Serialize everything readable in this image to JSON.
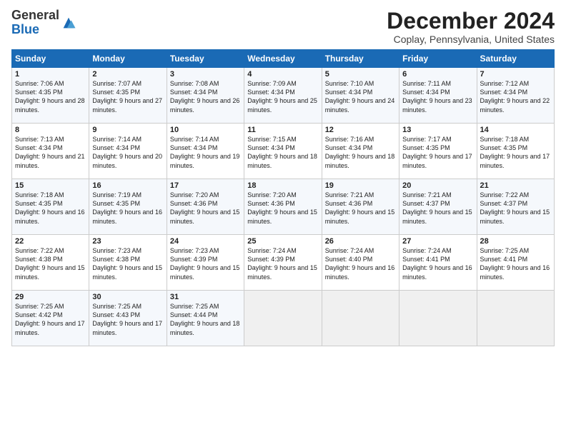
{
  "logo": {
    "general": "General",
    "blue": "Blue"
  },
  "title": "December 2024",
  "location": "Coplay, Pennsylvania, United States",
  "days_of_week": [
    "Sunday",
    "Monday",
    "Tuesday",
    "Wednesday",
    "Thursday",
    "Friday",
    "Saturday"
  ],
  "weeks": [
    [
      {
        "day": "1",
        "sunrise": "7:06 AM",
        "sunset": "4:35 PM",
        "daylight": "9 hours and 28 minutes."
      },
      {
        "day": "2",
        "sunrise": "7:07 AM",
        "sunset": "4:35 PM",
        "daylight": "9 hours and 27 minutes."
      },
      {
        "day": "3",
        "sunrise": "7:08 AM",
        "sunset": "4:34 PM",
        "daylight": "9 hours and 26 minutes."
      },
      {
        "day": "4",
        "sunrise": "7:09 AM",
        "sunset": "4:34 PM",
        "daylight": "9 hours and 25 minutes."
      },
      {
        "day": "5",
        "sunrise": "7:10 AM",
        "sunset": "4:34 PM",
        "daylight": "9 hours and 24 minutes."
      },
      {
        "day": "6",
        "sunrise": "7:11 AM",
        "sunset": "4:34 PM",
        "daylight": "9 hours and 23 minutes."
      },
      {
        "day": "7",
        "sunrise": "7:12 AM",
        "sunset": "4:34 PM",
        "daylight": "9 hours and 22 minutes."
      }
    ],
    [
      {
        "day": "8",
        "sunrise": "7:13 AM",
        "sunset": "4:34 PM",
        "daylight": "9 hours and 21 minutes."
      },
      {
        "day": "9",
        "sunrise": "7:14 AM",
        "sunset": "4:34 PM",
        "daylight": "9 hours and 20 minutes."
      },
      {
        "day": "10",
        "sunrise": "7:14 AM",
        "sunset": "4:34 PM",
        "daylight": "9 hours and 19 minutes."
      },
      {
        "day": "11",
        "sunrise": "7:15 AM",
        "sunset": "4:34 PM",
        "daylight": "9 hours and 18 minutes."
      },
      {
        "day": "12",
        "sunrise": "7:16 AM",
        "sunset": "4:34 PM",
        "daylight": "9 hours and 18 minutes."
      },
      {
        "day": "13",
        "sunrise": "7:17 AM",
        "sunset": "4:35 PM",
        "daylight": "9 hours and 17 minutes."
      },
      {
        "day": "14",
        "sunrise": "7:18 AM",
        "sunset": "4:35 PM",
        "daylight": "9 hours and 17 minutes."
      }
    ],
    [
      {
        "day": "15",
        "sunrise": "7:18 AM",
        "sunset": "4:35 PM",
        "daylight": "9 hours and 16 minutes."
      },
      {
        "day": "16",
        "sunrise": "7:19 AM",
        "sunset": "4:35 PM",
        "daylight": "9 hours and 16 minutes."
      },
      {
        "day": "17",
        "sunrise": "7:20 AM",
        "sunset": "4:36 PM",
        "daylight": "9 hours and 15 minutes."
      },
      {
        "day": "18",
        "sunrise": "7:20 AM",
        "sunset": "4:36 PM",
        "daylight": "9 hours and 15 minutes."
      },
      {
        "day": "19",
        "sunrise": "7:21 AM",
        "sunset": "4:36 PM",
        "daylight": "9 hours and 15 minutes."
      },
      {
        "day": "20",
        "sunrise": "7:21 AM",
        "sunset": "4:37 PM",
        "daylight": "9 hours and 15 minutes."
      },
      {
        "day": "21",
        "sunrise": "7:22 AM",
        "sunset": "4:37 PM",
        "daylight": "9 hours and 15 minutes."
      }
    ],
    [
      {
        "day": "22",
        "sunrise": "7:22 AM",
        "sunset": "4:38 PM",
        "daylight": "9 hours and 15 minutes."
      },
      {
        "day": "23",
        "sunrise": "7:23 AM",
        "sunset": "4:38 PM",
        "daylight": "9 hours and 15 minutes."
      },
      {
        "day": "24",
        "sunrise": "7:23 AM",
        "sunset": "4:39 PM",
        "daylight": "9 hours and 15 minutes."
      },
      {
        "day": "25",
        "sunrise": "7:24 AM",
        "sunset": "4:39 PM",
        "daylight": "9 hours and 15 minutes."
      },
      {
        "day": "26",
        "sunrise": "7:24 AM",
        "sunset": "4:40 PM",
        "daylight": "9 hours and 16 minutes."
      },
      {
        "day": "27",
        "sunrise": "7:24 AM",
        "sunset": "4:41 PM",
        "daylight": "9 hours and 16 minutes."
      },
      {
        "day": "28",
        "sunrise": "7:25 AM",
        "sunset": "4:41 PM",
        "daylight": "9 hours and 16 minutes."
      }
    ],
    [
      {
        "day": "29",
        "sunrise": "7:25 AM",
        "sunset": "4:42 PM",
        "daylight": "9 hours and 17 minutes."
      },
      {
        "day": "30",
        "sunrise": "7:25 AM",
        "sunset": "4:43 PM",
        "daylight": "9 hours and 17 minutes."
      },
      {
        "day": "31",
        "sunrise": "7:25 AM",
        "sunset": "4:44 PM",
        "daylight": "9 hours and 18 minutes."
      },
      null,
      null,
      null,
      null
    ]
  ]
}
